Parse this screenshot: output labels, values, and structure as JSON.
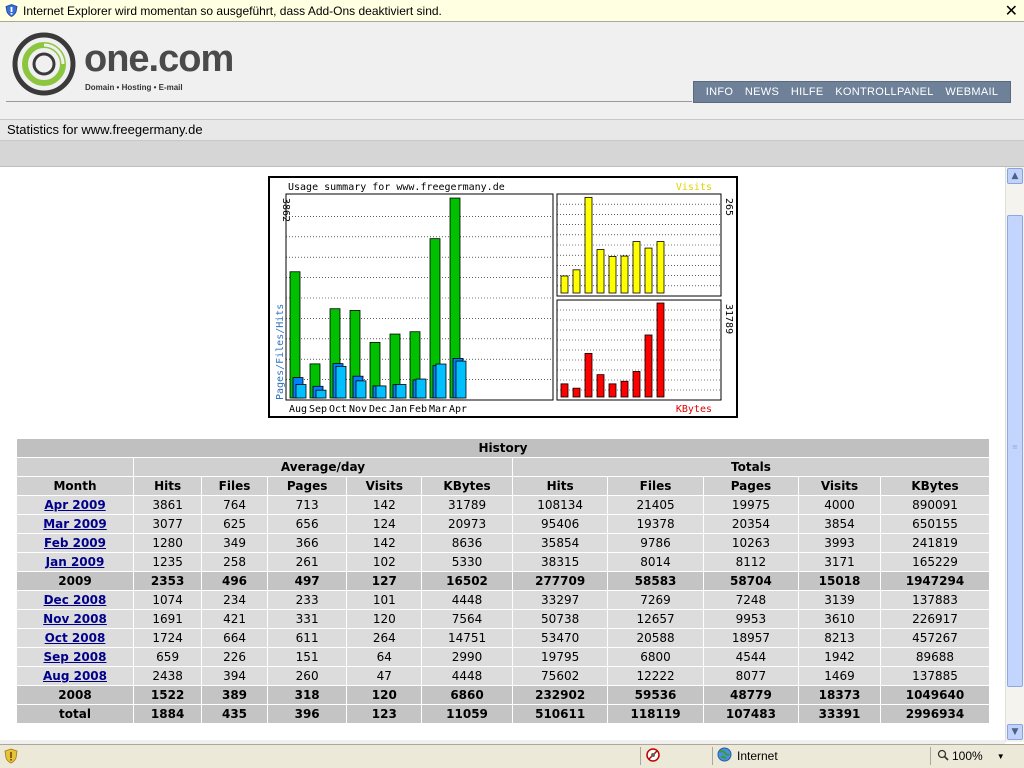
{
  "infobar": {
    "message": "Internet Explorer wird momentan so ausgeführt, dass Add-Ons deaktiviert sind.",
    "close": "✕"
  },
  "header": {
    "brand": "one.com",
    "tagline": "Domain • Hosting • E-mail",
    "nav": [
      "INFO",
      "NEWS",
      "HILFE",
      "KONTROLLPANEL",
      "WEBMAIL"
    ]
  },
  "stats_title": "Statistics for www.freegermany.de",
  "chart_data": {
    "type": "bar",
    "title": "Usage summary for www.freegermany.de",
    "categories": [
      "Aug",
      "Sep",
      "Oct",
      "Nov",
      "Dec",
      "Jan",
      "Feb",
      "Mar",
      "Apr"
    ],
    "left_axis_max_label": "3862",
    "left_axis_label": "Pages/Files/Hits",
    "series": [
      {
        "name": "Hits",
        "color": "#00c000",
        "values": [
          2438,
          659,
          1724,
          1691,
          1074,
          1235,
          1280,
          3077,
          3861
        ]
      },
      {
        "name": "Files",
        "color": "#0080ff",
        "values": [
          394,
          226,
          664,
          421,
          234,
          258,
          349,
          625,
          764
        ]
      },
      {
        "name": "Pages",
        "color": "#00c0ff",
        "values": [
          260,
          151,
          611,
          331,
          233,
          261,
          366,
          656,
          713
        ]
      }
    ],
    "visits": {
      "label": "Visits",
      "max_label": "265",
      "max": 265,
      "color": "#ffff00",
      "values": [
        47,
        64,
        264,
        120,
        101,
        102,
        142,
        124,
        142
      ]
    },
    "kbytes": {
      "label": "KBytes",
      "max_label": "31789",
      "max": 31789,
      "color": "#ff0000",
      "values": [
        4448,
        2990,
        14751,
        7564,
        4448,
        5330,
        8636,
        20973,
        31789
      ]
    }
  },
  "table": {
    "title": "History",
    "group_avg": "Average/day",
    "group_tot": "Totals",
    "columns": [
      "Month",
      "Hits",
      "Files",
      "Pages",
      "Visits",
      "KBytes",
      "Hits",
      "Files",
      "Pages",
      "Visits",
      "KBytes"
    ],
    "rows": [
      {
        "link": true,
        "cells": [
          "Apr 2009",
          "3861",
          "764",
          "713",
          "142",
          "31789",
          "108134",
          "21405",
          "19975",
          "4000",
          "890091"
        ]
      },
      {
        "link": true,
        "cells": [
          "Mar 2009",
          "3077",
          "625",
          "656",
          "124",
          "20973",
          "95406",
          "19378",
          "20354",
          "3854",
          "650155"
        ]
      },
      {
        "link": true,
        "cells": [
          "Feb 2009",
          "1280",
          "349",
          "366",
          "142",
          "8636",
          "35854",
          "9786",
          "10263",
          "3993",
          "241819"
        ]
      },
      {
        "link": true,
        "cells": [
          "Jan 2009",
          "1235",
          "258",
          "261",
          "102",
          "5330",
          "38315",
          "8014",
          "8112",
          "3171",
          "165229"
        ]
      },
      {
        "link": false,
        "cells": [
          "2009",
          "2353",
          "496",
          "497",
          "127",
          "16502",
          "277709",
          "58583",
          "58704",
          "15018",
          "1947294"
        ]
      },
      {
        "link": true,
        "cells": [
          "Dec 2008",
          "1074",
          "234",
          "233",
          "101",
          "4448",
          "33297",
          "7269",
          "7248",
          "3139",
          "137883"
        ]
      },
      {
        "link": true,
        "cells": [
          "Nov 2008",
          "1691",
          "421",
          "331",
          "120",
          "7564",
          "50738",
          "12657",
          "9953",
          "3610",
          "226917"
        ]
      },
      {
        "link": true,
        "cells": [
          "Oct 2008",
          "1724",
          "664",
          "611",
          "264",
          "14751",
          "53470",
          "20588",
          "18957",
          "8213",
          "457267"
        ]
      },
      {
        "link": true,
        "cells": [
          "Sep 2008",
          "659",
          "226",
          "151",
          "64",
          "2990",
          "19795",
          "6800",
          "4544",
          "1942",
          "89688"
        ]
      },
      {
        "link": true,
        "cells": [
          "Aug 2008",
          "2438",
          "394",
          "260",
          "47",
          "4448",
          "75602",
          "12222",
          "8077",
          "1469",
          "137885"
        ]
      },
      {
        "link": false,
        "cells": [
          "2008",
          "1522",
          "389",
          "318",
          "120",
          "6860",
          "232902",
          "59536",
          "48779",
          "18373",
          "1049640"
        ]
      },
      {
        "link": false,
        "cells": [
          "total",
          "1884",
          "435",
          "396",
          "123",
          "11059",
          "510611",
          "118119",
          "107483",
          "33391",
          "2996934"
        ]
      }
    ]
  },
  "statusbar": {
    "zone": "Internet",
    "zoom": "100%"
  },
  "colors": {
    "nav_bg": "#6e8199",
    "table_header": "#c0c0c0",
    "table_cell": "#dcdcdc",
    "link": "#00008b",
    "logo_green": "#8cc63f"
  }
}
